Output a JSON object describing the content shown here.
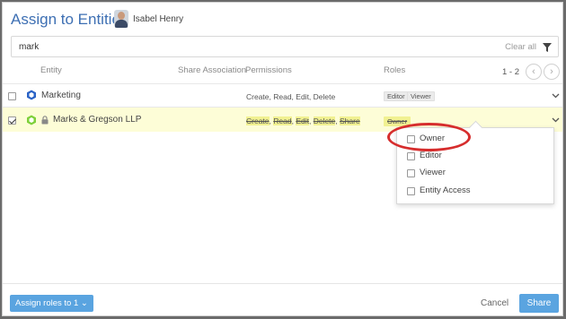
{
  "header": {
    "title": "Assign to Entities",
    "user_name": "Isabel Henry"
  },
  "search": {
    "value": "mark",
    "clear_label": "Clear all"
  },
  "columns": [
    "Entity",
    "Share Association",
    "Permissions",
    "Roles"
  ],
  "pager": {
    "text": "1 - 2",
    "prev": "‹",
    "next": "›"
  },
  "rows": [
    {
      "name": "Marketing",
      "checked": false,
      "permissions": "Create, Read, Edit, Delete",
      "roles": [
        "Editor",
        "Viewer"
      ]
    },
    {
      "name": "Marks & Gregson LLP",
      "checked": true,
      "locked": true,
      "permissions": [
        "Create",
        "Read",
        "Edit",
        "Delete",
        "Share"
      ],
      "roles": [
        "Owner"
      ]
    }
  ],
  "dropdown": {
    "items": [
      "Owner",
      "Editor",
      "Viewer",
      "Entity Access"
    ]
  },
  "footer": {
    "assign_label": "Assign roles to 1 ⌄",
    "cancel_label": "Cancel",
    "share_label": "Share"
  },
  "colors": {
    "accent": "#5aa4e0",
    "title": "#3d6fb3",
    "highlight_row": "#fdfdd7",
    "annotation": "#d62d2d"
  }
}
